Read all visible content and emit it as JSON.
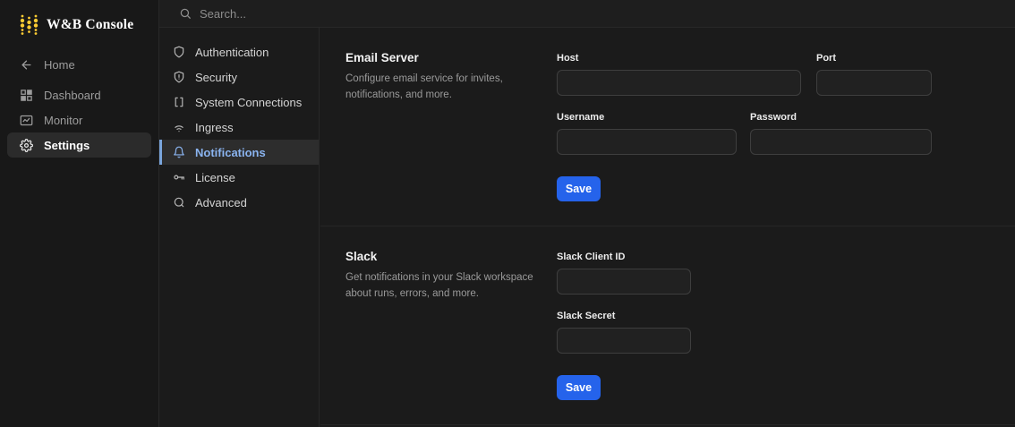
{
  "app": {
    "title": "W&B Console"
  },
  "topbar": {
    "search_placeholder": "Search..."
  },
  "sidebar": {
    "items": [
      {
        "label": "Home",
        "icon": "arrow-left-icon",
        "selected": false
      },
      {
        "label": "Dashboard",
        "icon": "grid-icon",
        "selected": false
      },
      {
        "label": "Monitor",
        "icon": "monitor-chart-icon",
        "selected": false
      },
      {
        "label": "Settings",
        "icon": "gear-icon",
        "selected": true
      }
    ]
  },
  "settings_nav": {
    "items": [
      {
        "label": "Authentication",
        "icon": "shield-icon",
        "selected": false
      },
      {
        "label": "Security",
        "icon": "shield-alert-icon",
        "selected": false
      },
      {
        "label": "System Connections",
        "icon": "brackets-icon",
        "selected": false
      },
      {
        "label": "Ingress",
        "icon": "wifi-icon",
        "selected": false
      },
      {
        "label": "Notifications",
        "icon": "bell-icon",
        "selected": true
      },
      {
        "label": "License",
        "icon": "key-icon",
        "selected": false
      },
      {
        "label": "Advanced",
        "icon": "advanced-icon",
        "selected": false
      }
    ]
  },
  "sections": [
    {
      "title": "Email Server",
      "description": "Configure email service for invites, notifications, and more.",
      "fields": [
        {
          "label": "Host",
          "value": "",
          "placeholder": ""
        },
        {
          "label": "Port",
          "value": "",
          "placeholder": ""
        },
        {
          "label": "Username",
          "value": "",
          "placeholder": ""
        },
        {
          "label": "Password",
          "value": "",
          "placeholder": ""
        }
      ],
      "save_label": "Save"
    },
    {
      "title": "Slack",
      "description": "Get notifications in your Slack workspace about runs, errors, and more.",
      "fields": [
        {
          "label": "Slack Client ID",
          "value": "",
          "placeholder": ""
        },
        {
          "label": "Slack Secret",
          "value": "",
          "placeholder": ""
        }
      ],
      "save_label": "Save"
    }
  ],
  "colors": {
    "background": "#1b1b1b",
    "sidebar_background": "#181818",
    "divider": "#282828",
    "accent_blue": "#2563eb",
    "selected_nav_text": "#8ab4f0",
    "selected_nav_border": "#7aa5dc",
    "logo_yellow": "#ffcc33",
    "muted_text": "#9a9a9a"
  }
}
